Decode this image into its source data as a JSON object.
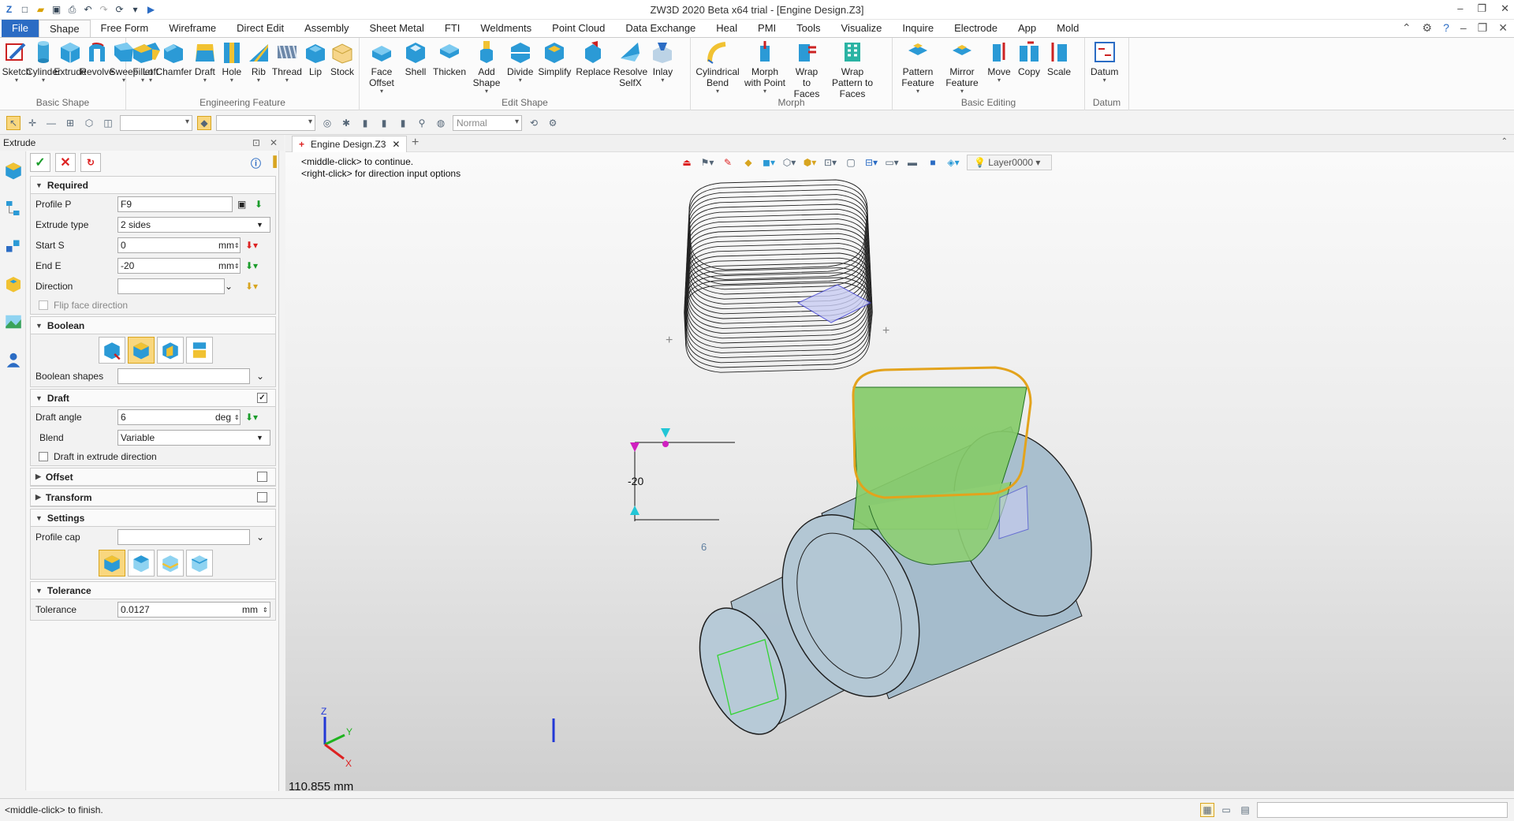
{
  "window": {
    "title": "ZW3D 2020 Beta x64 trial - [Engine Design.Z3]"
  },
  "menu": {
    "tabs": [
      "File",
      "Shape",
      "Free Form",
      "Wireframe",
      "Direct Edit",
      "Assembly",
      "Sheet Metal",
      "FTI",
      "Weldments",
      "Point Cloud",
      "Data Exchange",
      "Heal",
      "PMI",
      "Tools",
      "Visualize",
      "Inquire",
      "Electrode",
      "App",
      "Mold"
    ],
    "active": "Shape"
  },
  "ribbon": {
    "groups": [
      {
        "label": "Basic Shape",
        "buttons": [
          "Sketch",
          "Cylinder",
          "Extrude",
          "Revolve",
          "Sweep",
          "Loft"
        ]
      },
      {
        "label": "Engineering Feature",
        "buttons": [
          "Fillet",
          "Chamfer",
          "Draft",
          "Hole",
          "Rib",
          "Thread",
          "Lip",
          "Stock"
        ]
      },
      {
        "label": "Edit Shape",
        "buttons": [
          "Face Offset",
          "Shell",
          "Thicken",
          "Add Shape",
          "Divide",
          "Simplify",
          "Replace",
          "Resolve SelfX",
          "Inlay"
        ]
      },
      {
        "label": "Morph",
        "buttons": [
          "Cylindrical Bend",
          "Morph with Point",
          "Wrap to Faces",
          "Wrap Pattern to Faces"
        ]
      },
      {
        "label": "Basic Editing",
        "buttons": [
          "Pattern Feature",
          "Mirror Feature",
          "Move",
          "Copy",
          "Scale"
        ]
      },
      {
        "label": "Datum",
        "buttons": [
          "Datum"
        ]
      }
    ]
  },
  "toolbar2": {
    "render_mode": "Normal"
  },
  "panel": {
    "title": "Extrude",
    "required": {
      "header": "Required",
      "profile_label": "Profile P",
      "profile_value": "F9",
      "type_label": "Extrude type",
      "type_value": "2 sides",
      "start_label": "Start S",
      "start_value": "0",
      "start_unit": "mm",
      "end_label": "End E",
      "end_value": "-20",
      "end_unit": "mm",
      "direction_label": "Direction",
      "direction_value": "",
      "flip_label": "Flip face direction"
    },
    "boolean": {
      "header": "Boolean",
      "shapes_label": "Boolean shapes"
    },
    "draft": {
      "header": "Draft",
      "angle_label": "Draft angle",
      "angle_value": "6",
      "angle_unit": "deg",
      "blend_label": "Blend",
      "blend_value": "Variable",
      "dir_label": "Draft in extrude direction"
    },
    "offset": {
      "header": "Offset"
    },
    "transform": {
      "header": "Transform"
    },
    "settings": {
      "header": "Settings",
      "cap_label": "Profile cap"
    },
    "tolerance": {
      "header": "Tolerance",
      "label": "Tolerance",
      "value": "0.0127",
      "unit": "mm"
    }
  },
  "document": {
    "tab": "Engine Design.Z3"
  },
  "viewport": {
    "hint1": "<middle-click> to continue.",
    "hint2": "<right-click> for direction input options",
    "layer": "Layer0000",
    "measure": "110.855 mm",
    "dim_label": "-20",
    "draft_label": "6",
    "axes": {
      "x": "X",
      "y": "Y",
      "z": "Z"
    }
  },
  "status": {
    "text": "<middle-click> to finish."
  }
}
